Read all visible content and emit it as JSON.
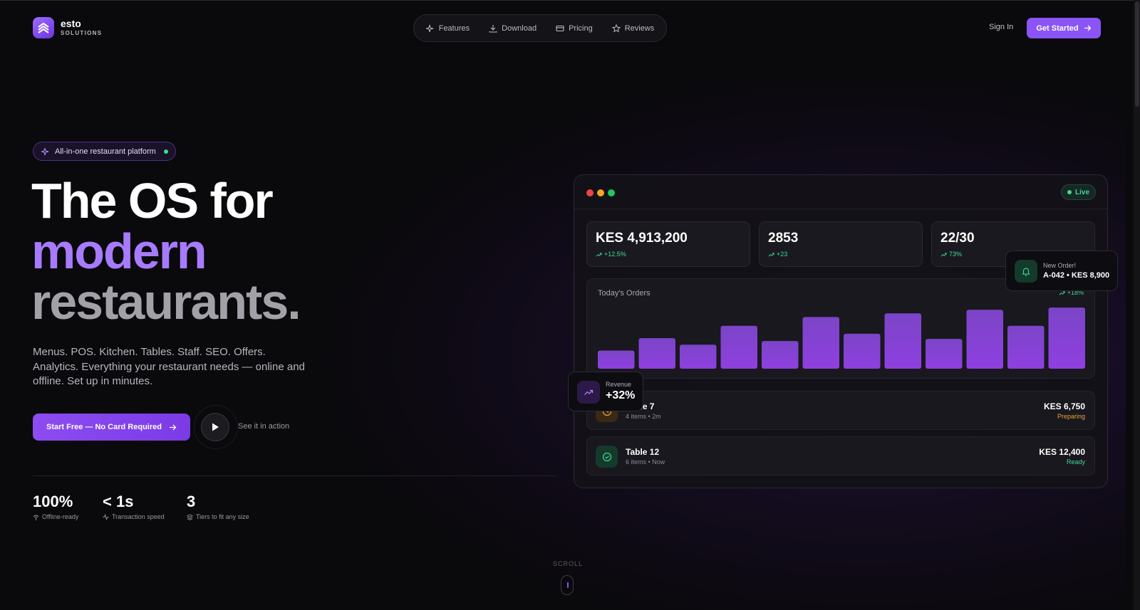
{
  "brand": {
    "name": "esto",
    "tagline": "SOLUTIONS"
  },
  "nav": {
    "items": [
      {
        "label": "Features",
        "icon": "sparkles-icon"
      },
      {
        "label": "Download",
        "icon": "download-icon"
      },
      {
        "label": "Pricing",
        "icon": "credit-card-icon"
      },
      {
        "label": "Reviews",
        "icon": "star-icon"
      }
    ]
  },
  "header": {
    "signin": "Sign In",
    "cta": "Get Started"
  },
  "hero": {
    "badge": "All-in-one restaurant platform",
    "line1": "The OS for",
    "line2": "modern",
    "line3": "restaurants.",
    "subcopy": "Menus. POS. Kitchen. Tables. Staff. SEO. Offers. Analytics. Everything your restaurant needs — online and offline. Set up in minutes.",
    "cta_primary": "Start Free — No Card Required",
    "cta_secondary": "See it in action"
  },
  "stats": [
    {
      "value": "100%",
      "label": "Offline-ready",
      "icon": "wifi-icon"
    },
    {
      "value": "< 1s",
      "label": "Transaction speed",
      "icon": "activity-icon"
    },
    {
      "value": "3",
      "label": "Tiers to fit any size",
      "icon": "layers-icon"
    }
  ],
  "scroll": {
    "label": "SCROLL"
  },
  "dashboard": {
    "live": "Live",
    "kpis": [
      {
        "value": "KES 4,913,200",
        "delta": "+12.5%"
      },
      {
        "value": "2853",
        "delta": "+23"
      },
      {
        "value": "22/30",
        "delta": "73%"
      }
    ],
    "orders_title": "Today's Orders",
    "orders_delta": "+18%",
    "rows": [
      {
        "name": "Table 7",
        "sub": "4 items • 2m",
        "amount": "KES 6,750",
        "status": "Preparing"
      },
      {
        "name": "Table 12",
        "sub": "6 items • Now",
        "amount": "KES 12,400",
        "status": "Ready"
      }
    ]
  },
  "chart_data": {
    "type": "bar",
    "title": "Today's Orders",
    "values": [
      25,
      42,
      33,
      59,
      38,
      71,
      48,
      76,
      41,
      81,
      59,
      84
    ],
    "ylim": [
      0,
      90
    ],
    "color": "#7a3cc9"
  },
  "toast": {
    "title": "New Order!",
    "body": "A-042 • KES 8,900"
  },
  "revenue": {
    "label": "Revenue",
    "value": "+32%"
  },
  "colors": {
    "accent": "#8b54f6",
    "success": "#3ddc97",
    "warning": "#e8a33a"
  }
}
